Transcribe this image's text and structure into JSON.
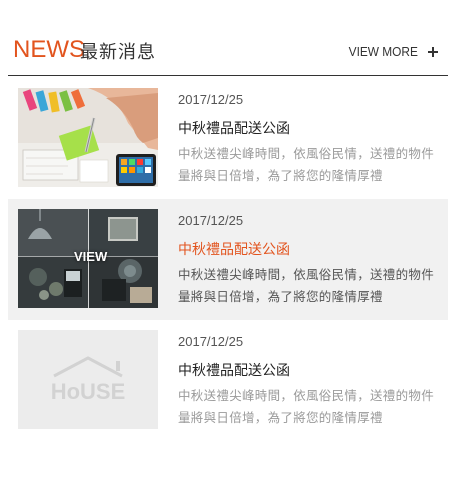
{
  "header": {
    "title_en": "NEWS",
    "title_zh": "最新消息",
    "view_more": "VIEW MORE"
  },
  "colors": {
    "accent": "#e2541e",
    "text_dark": "#333333",
    "text_muted": "#9a9a9a",
    "hover_bg": "#f1f1f1"
  },
  "news": [
    {
      "date": "2017/12/25",
      "title": "中秋禮品配送公函",
      "excerpt": "中秋送禮尖峰時間，依風俗民情，送禮的物件量將與日倍增，為了將您的隆情厚禮",
      "image": "office-desk-drawing-photo",
      "state": "normal"
    },
    {
      "date": "2017/12/25",
      "title": "中秋禮品配送公函",
      "excerpt": "中秋送禮尖峰時間，依風俗民情，送禮的物件量將與日倍增，為了將您的隆情厚禮",
      "image": "interior-moodboard-photo",
      "state": "hover",
      "overlay_label": "VIEW"
    },
    {
      "date": "2017/12/25",
      "title": "中秋禮品配送公函",
      "excerpt": "中秋送禮尖峰時間，依風俗民情，送禮的物件量將與日倍增，為了將您的隆情厚禮",
      "image": "house-placeholder-logo",
      "state": "normal"
    }
  ]
}
